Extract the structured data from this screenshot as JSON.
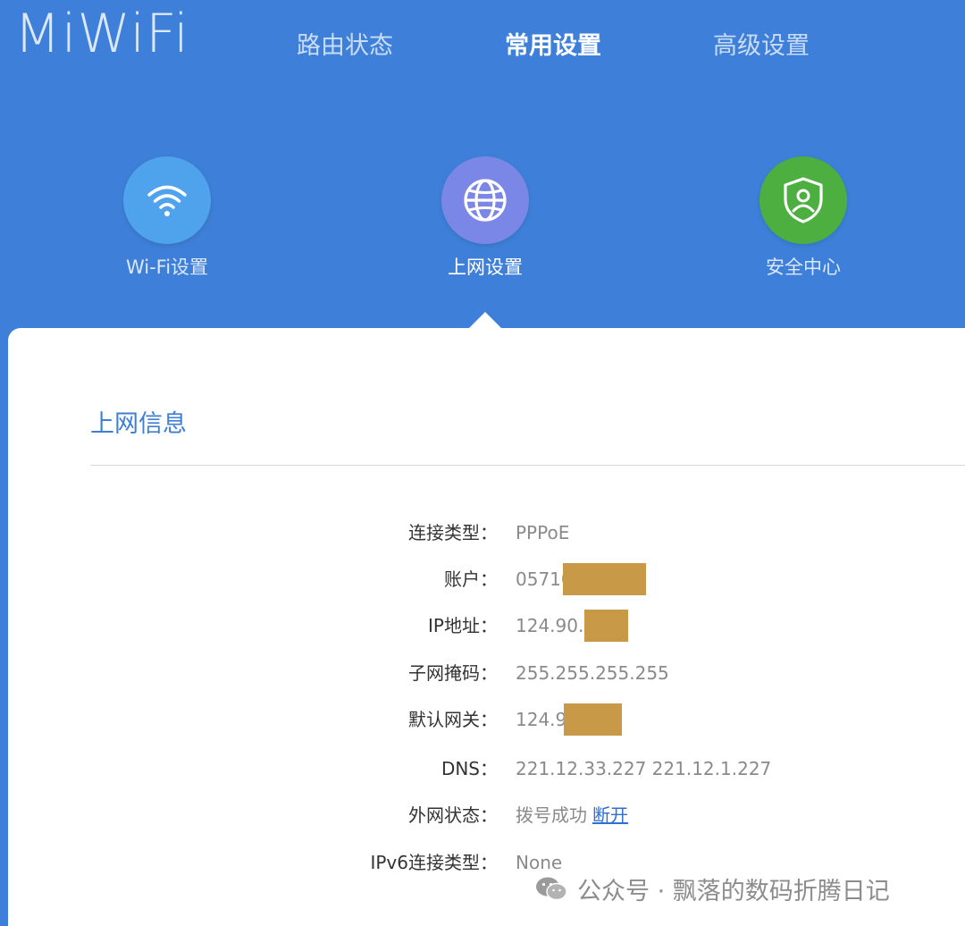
{
  "brand": {
    "logo_text": "MiWiFi"
  },
  "nav": {
    "tabs": [
      {
        "label": "路由状态",
        "active": false
      },
      {
        "label": "常用设置",
        "active": true
      },
      {
        "label": "高级设置",
        "active": false
      }
    ]
  },
  "functions": [
    {
      "label": "Wi-Fi设置",
      "icon": "wifi-icon",
      "color": "#4fa2ec",
      "active": false
    },
    {
      "label": "上网设置",
      "icon": "globe-icon",
      "color": "#7b87e6",
      "active": true
    },
    {
      "label": "安全中心",
      "icon": "shield-user-icon",
      "color": "#4caf3f",
      "active": false
    }
  ],
  "section": {
    "title": "上网信息"
  },
  "info": {
    "connection_type": {
      "label": "连接类型：",
      "value": "PPPoE"
    },
    "account": {
      "label": "账户：",
      "value": "05710"
    },
    "ip": {
      "label": "IP地址：",
      "value": "124.90.8"
    },
    "subnet": {
      "label": "子网掩码：",
      "value": "255.255.255.255"
    },
    "gateway": {
      "label": "默认网关：",
      "value": "124.90"
    },
    "dns": {
      "label": "DNS：",
      "value": "221.12.33.227 221.12.1.227"
    },
    "wan_status": {
      "label": "外网状态：",
      "value": "拨号成功",
      "action": "断开"
    },
    "ipv6_type": {
      "label": "IPv6连接类型：",
      "value": "None"
    }
  },
  "watermark": {
    "text": "公众号 · 飘落的数码折腾日记"
  },
  "colors": {
    "header_bg": "#3e80d9",
    "accent_title": "#3e7fd4",
    "link": "#2f6ed3",
    "redaction": "#c89a48"
  }
}
